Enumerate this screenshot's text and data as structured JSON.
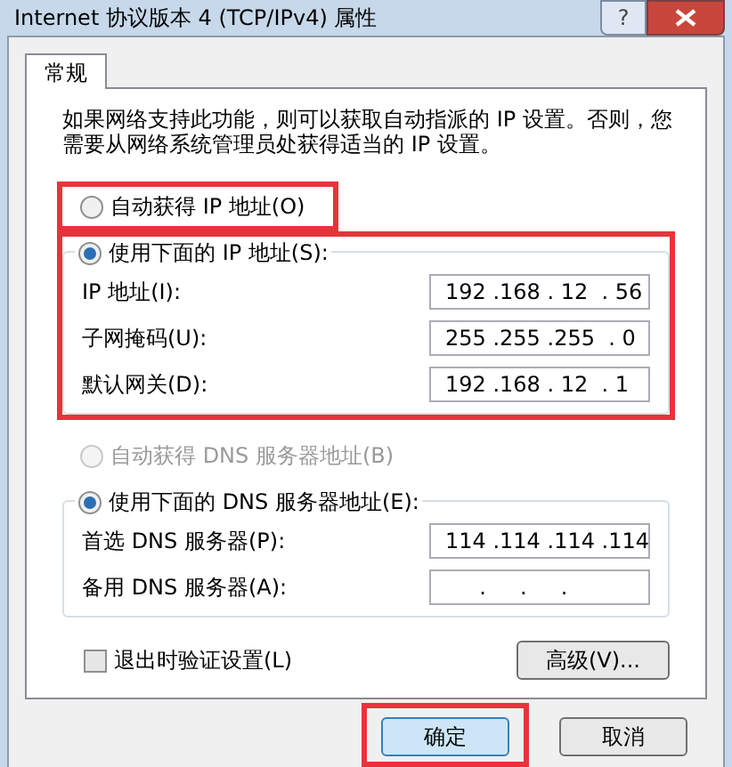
{
  "window": {
    "title": "Internet 协议版本 4 (TCP/IPv4) 属性",
    "help": "?"
  },
  "tabs": [
    {
      "label": "常规",
      "selected": true
    }
  ],
  "intro": "如果网络支持此功能，则可以获取自动指派的 IP 设置。否则，您需要从网络系统管理员处获得适当的 IP 设置。",
  "ip": {
    "auto": {
      "label": "自动获得 IP 地址(O)",
      "selected": false,
      "disabled": false,
      "highlighted": true
    },
    "manual": {
      "label": "使用下面的 IP 地址(S):",
      "selected": true,
      "disabled": false,
      "highlighted": true
    },
    "fields": [
      {
        "label": "IP 地址(I):",
        "value": "192 .168 . 12  . 56"
      },
      {
        "label": "子网掩码(U):",
        "value": "255 .255 .255  . 0"
      },
      {
        "label": "默认网关(D):",
        "value": "192 .168 . 12  . 1"
      }
    ]
  },
  "dns": {
    "auto": {
      "label": "自动获得 DNS 服务器地址(B)",
      "selected": false,
      "disabled": true,
      "highlighted": false
    },
    "manual": {
      "label": "使用下面的 DNS 服务器地址(E):",
      "selected": true,
      "disabled": false,
      "highlighted": false
    },
    "fields": [
      {
        "label": "首选 DNS 服务器(P):",
        "value": "114 .114 .114 .114"
      },
      {
        "label": "备用 DNS 服务器(A):",
        "value": "     .     .     ."
      }
    ]
  },
  "validate": {
    "label": "退出时验证设置(L)",
    "checked": false
  },
  "advanced": {
    "label": "高级(V)..."
  },
  "footer_buttons": [
    {
      "label": "确定",
      "default": true,
      "highlighted": true
    },
    {
      "label": "取消",
      "default": false,
      "highlighted": false
    }
  ]
}
